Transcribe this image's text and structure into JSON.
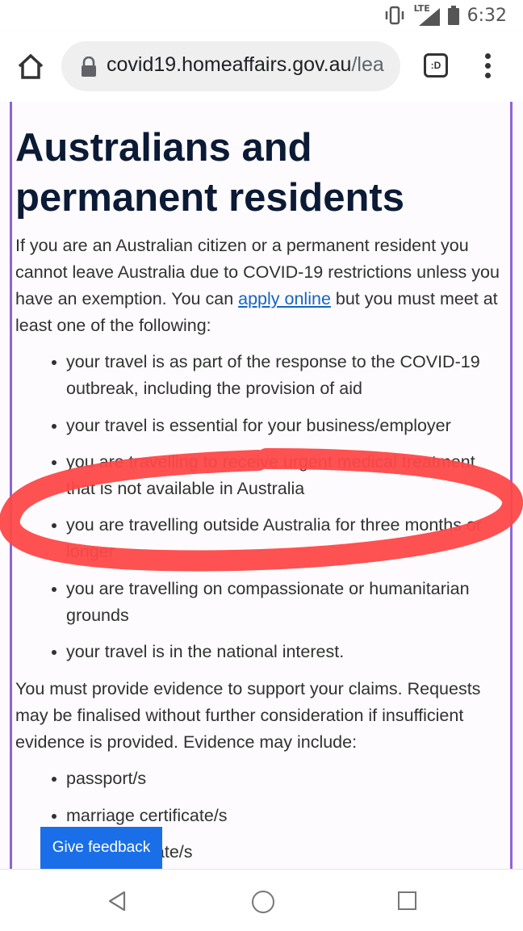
{
  "status_bar": {
    "time": "6:32",
    "network_label": "LTE",
    "icons": [
      "vibrate-icon",
      "signal-icon",
      "battery-icon"
    ]
  },
  "browser": {
    "url_domain": "covid19.homeaffairs.gov.au",
    "url_path": "/lea",
    "tabs_label": ":D",
    "icons": [
      "home-icon",
      "lock-icon",
      "tabs-icon",
      "more-vert-icon"
    ]
  },
  "page": {
    "title_line1": "Australians and",
    "title_line2": "permanent residents",
    "intro": {
      "line1": "If you are an Australian citizen or a permanent resident you",
      "line2": "cannot leave Australia due to COVID-19 restrictions unless you",
      "line3_before": "have an exemption. You can ",
      "line3_link": "apply online",
      "line3_after": " but you must meet at",
      "line4": "least one of the following:"
    },
    "reasons": [
      {
        "l1": "your travel is as part of the response to the COVID-19",
        "l2": "outbreak, including the provision of aid"
      },
      {
        "l1": "your travel is essential for your business/employer",
        "l2": ""
      },
      {
        "l1": "you are travelling to receive urgent medical treatment",
        "l2": "that is not available in Australia"
      },
      {
        "l1": "you are travelling outside Australia for three months or",
        "l2": "longer"
      },
      {
        "l1": "you are travelling on compassionate or humanitarian",
        "l2": "grounds"
      },
      {
        "l1": "your travel is in the national interest.",
        "l2": ""
      }
    ],
    "evidence_intro": {
      "line1": "You must provide evidence to support your claims. Requests",
      "line2": "may be finalised without further consideration if insufficient",
      "line3": "evidence is provided. Evidence may include:"
    },
    "evidence": [
      "passport/s",
      "marriage certificate/s",
      "birth certificate/s"
    ],
    "feedback_label": "Give feedback"
  },
  "colors": {
    "accent_border": "#9163d6",
    "title": "#0b1a35",
    "link": "#1565c0",
    "feedback_button": "#1a6fe8",
    "annotation": "#fe4848"
  },
  "nav_bar": {
    "icons": [
      "back-icon",
      "home-circle-icon",
      "recents-icon"
    ]
  }
}
